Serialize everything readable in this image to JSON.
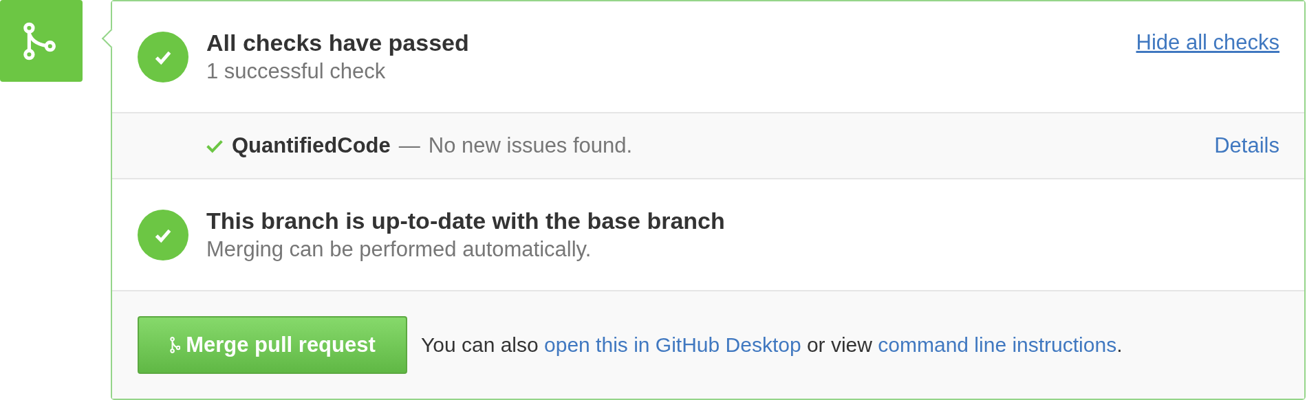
{
  "summary": {
    "passed": true,
    "title": "All checks have passed",
    "subtitle": "1 successful check",
    "toggle": "Hide all checks"
  },
  "checks": [
    {
      "passed": true,
      "name": "QuantifiedCode",
      "separator": "—",
      "description": "No new issues found.",
      "link": "Details"
    }
  ],
  "branch": {
    "passed": true,
    "title": "This branch is up-to-date with the base branch",
    "subtitle": "Merging can be performed automatically."
  },
  "merge": {
    "button": "Merge pull request",
    "note": [
      {
        "kind": "text",
        "text": "You can also"
      },
      {
        "kind": "link",
        "text": "open this in GitHub Desktop"
      },
      {
        "kind": "text",
        "text": "or view"
      },
      {
        "kind": "link",
        "text": "command line instructions"
      },
      {
        "kind": "text",
        "text": "."
      }
    ]
  }
}
